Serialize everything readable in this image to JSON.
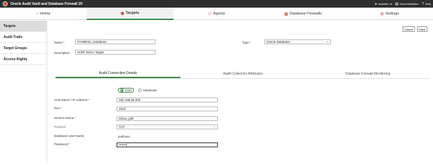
{
  "header": {
    "title": "Oracle Audit Vault and Database Firewall 20",
    "user": "avadmin",
    "documentation": "Documentation",
    "help": "Help"
  },
  "nav": {
    "tabs": [
      {
        "label": "Home",
        "icon": "home-icon"
      },
      {
        "label": "Targets",
        "icon": "targets-icon"
      },
      {
        "label": "Agents",
        "icon": "agents-icon"
      },
      {
        "label": "Database Firewalls",
        "icon": "firewall-icon"
      },
      {
        "label": "Settings",
        "icon": "gear-icon"
      }
    ]
  },
  "sidebar": {
    "items": [
      {
        "label": "Targets"
      },
      {
        "label": "Audit Trails"
      },
      {
        "label": "Target Groups"
      },
      {
        "label": "Access Rights"
      }
    ]
  },
  "actions": {
    "cancel": "Cancel",
    "save": "Save"
  },
  "form": {
    "name_label": "Name",
    "name_value": "TVHIB031_Database",
    "type_label": "Type",
    "type_value": "Oracle Database",
    "description_label": "Description",
    "description_value": "AVDF Demo Target"
  },
  "subtabs": [
    {
      "label": "Audit Connection Details"
    },
    {
      "label": "Audit Collection Attributes"
    },
    {
      "label": "Database Firewall Monitoring"
    }
  ],
  "connection": {
    "mode_options": [
      "Core",
      "Advanced"
    ],
    "mode_selected": "Core",
    "host_label": "Host Name / IP Address",
    "host_value": "192.168.56.200",
    "port_label": "Port",
    "port_value": "1528",
    "service_label": "Service Name",
    "service_value": "tvhiva_pdb",
    "protocol_label": "Protocol",
    "protocol_value": "TCP",
    "dbuser_label": "Database User Name",
    "dbuser_value": "avdfuser",
    "password_label": "Password",
    "password_value": "•••••••|"
  }
}
